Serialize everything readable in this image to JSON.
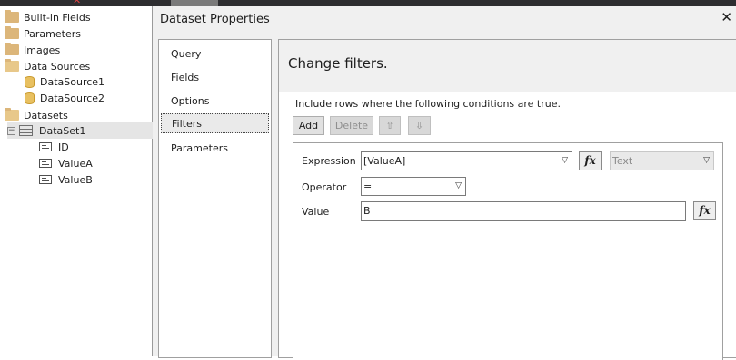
{
  "tree": {
    "items": [
      {
        "label": "Built-in Fields",
        "icon": "folder-icon"
      },
      {
        "label": "Parameters",
        "icon": "folder-icon"
      },
      {
        "label": "Images",
        "icon": "folder-icon"
      },
      {
        "label": "Data Sources",
        "icon": "folder-open-icon"
      },
      {
        "label": "DataSource1",
        "icon": "database-icon"
      },
      {
        "label": "DataSource2",
        "icon": "database-icon"
      },
      {
        "label": "Datasets",
        "icon": "folder-open-icon"
      },
      {
        "label": "DataSet1",
        "icon": "table-icon",
        "expander": "−"
      },
      {
        "label": "ID",
        "icon": "field-icon"
      },
      {
        "label": "ValueA",
        "icon": "field-icon"
      },
      {
        "label": "ValueB",
        "icon": "field-icon"
      }
    ]
  },
  "dialog": {
    "title": "Dataset Properties",
    "close": "✕",
    "nav": [
      "Query",
      "Fields",
      "Options",
      "Filters",
      "Parameters"
    ],
    "heading": "Change filters.",
    "instruction": "Include rows where the following conditions are true.",
    "buttons": {
      "add": "Add",
      "delete": "Delete",
      "up": "⇧",
      "down": "⇩"
    },
    "filter": {
      "expression_label": "Expression",
      "expression_value": "[ValueA]",
      "type_value": "Text",
      "operator_label": "Operator",
      "operator_value": "=",
      "value_label": "Value",
      "value_value": "B",
      "fx": "fx"
    }
  },
  "colors": {
    "folder": "#dcb67a",
    "database": "#e8c060",
    "dialog_bg": "#f0f0f0"
  }
}
